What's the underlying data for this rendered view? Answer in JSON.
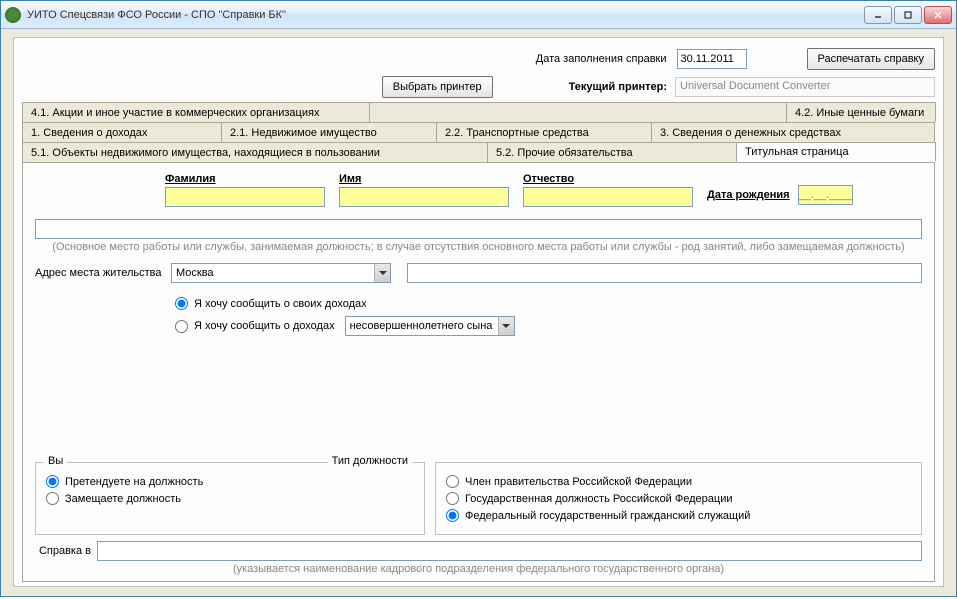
{
  "title": "УИТО Спецсвязи ФСО России - СПО \"Справки БК\"",
  "top": {
    "date_label": "Дата заполнения справки",
    "date_value": "30.11.2011",
    "print_btn": "Распечатать справку",
    "choose_printer_btn": "Выбрать принтер",
    "current_printer_label": "Текущий принтер:",
    "current_printer_value": "Universal Document Converter"
  },
  "tabs": {
    "row1": [
      "4.1. Акции и иное участие в коммерческих организациях",
      "",
      "4.2. Иные ценные бумаги"
    ],
    "row2": [
      "1. Сведения о доходах",
      "2.1. Недвижимое имущество",
      "2.2. Транспортные средства",
      "3. Сведения о денежных средствах"
    ],
    "row3": [
      "5.1. Объекты недвижимого имущества, находящиеся в пользовании",
      "5.2. Прочие обязательства",
      "Титульная страница"
    ]
  },
  "fields": {
    "lastname": "Фамилия",
    "firstname": "Имя",
    "patronymic": "Отчество",
    "birthdate": "Дата рождения",
    "birthdate_placeholder": "__.__.____",
    "workplace_hint": "(Основное место работы или службы, занимаемая должность; в случае отсутствия основного места работы или службы - род занятий, либо замещаемая должность)",
    "address_label": "Адрес места жительства",
    "address_value": "Москва"
  },
  "report": {
    "opt1": "Я хочу сообщить о своих доходах",
    "opt2": "Я хочу сообщить о доходах",
    "relative_value": "несовершеннолетнего сына"
  },
  "you": {
    "legend": "Вы",
    "opt1": "Претендуете на должность",
    "opt2": "Замещаете должность",
    "type_label": "Тип должности"
  },
  "position_type": {
    "opt1": "Член правительства Российской Федерации",
    "opt2": "Государственная должность Российской Федерации",
    "opt3": "Федеральный государственный гражданский служащий"
  },
  "spravka": {
    "label": "Справка в",
    "hint": "(указывается наименование кадрового подразделения федерального государственного органа)"
  }
}
